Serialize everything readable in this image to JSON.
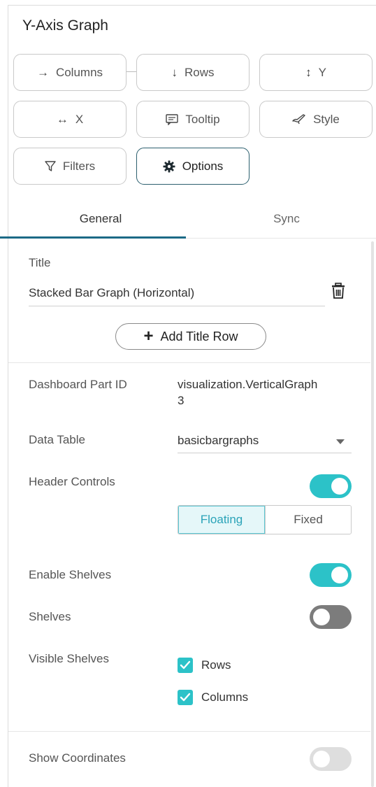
{
  "panel": {
    "title": "Y-Axis Graph"
  },
  "shelves": {
    "columns": {
      "label": "Columns",
      "icon": "arrow-right-icon"
    },
    "rows": {
      "label": "Rows",
      "icon": "arrow-down-icon"
    },
    "y": {
      "label": "Y",
      "icon": "arrow-up-down-icon"
    },
    "x": {
      "label": "X",
      "icon": "arrow-left-right-icon"
    },
    "tooltip": {
      "label": "Tooltip",
      "icon": "speech-bubble-icon"
    },
    "style": {
      "label": "Style",
      "icon": "paintbrush-icon"
    },
    "filters": {
      "label": "Filters",
      "icon": "funnel-icon"
    },
    "options": {
      "label": "Options",
      "icon": "gear-icon",
      "active": true
    }
  },
  "tabs": [
    {
      "label": "General",
      "selected": true
    },
    {
      "label": "Sync",
      "selected": false
    }
  ],
  "general": {
    "title_label": "Title",
    "title_value": "Stacked Bar Graph (Horizontal)",
    "add_title_row": "Add Title Row",
    "dashboard_part_id_label": "Dashboard Part ID",
    "dashboard_part_id_line1": "visualization.VerticalGraph",
    "dashboard_part_id_line2": "3",
    "data_table_label": "Data Table",
    "data_table_value": "basicbargraphs",
    "header_controls_label": "Header Controls",
    "header_controls_on": true,
    "header_mode_options": [
      "Floating",
      "Fixed"
    ],
    "header_mode_selected": "Floating",
    "enable_shelves_label": "Enable Shelves",
    "enable_shelves_on": true,
    "shelves_label": "Shelves",
    "shelves_on": false,
    "visible_shelves_label": "Visible Shelves",
    "visible_shelves": [
      {
        "label": "Rows",
        "checked": true
      },
      {
        "label": "Columns",
        "checked": true
      }
    ],
    "show_coordinates_label": "Show Coordinates",
    "show_coordinates_on": false
  },
  "colors": {
    "accent": "#2cc2c8",
    "tab_underline": "#1c6a86",
    "active_border": "#2c5f6e"
  }
}
